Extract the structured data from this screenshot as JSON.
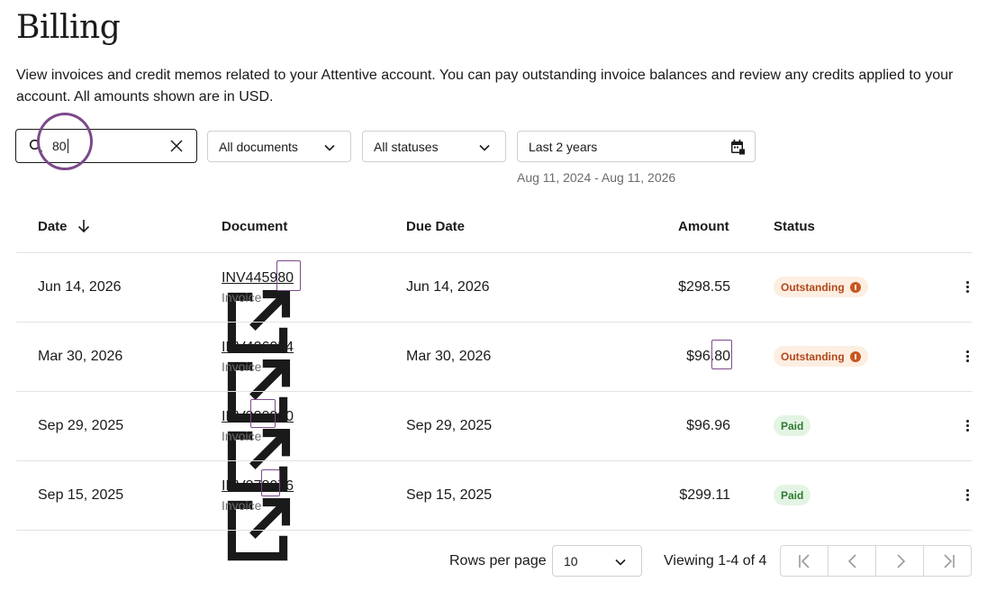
{
  "page": {
    "title": "Billing",
    "description": "View invoices and credit memos related to your Attentive account. You can pay outstanding invoice balances and review any credits applied to your account. All amounts shown are in USD."
  },
  "filters": {
    "search_value": "80",
    "document_select": "All documents",
    "status_select": "All statuses",
    "date_select": "Last 2 years",
    "date_range": "Aug 11, 2024 - Aug 11, 2026"
  },
  "table": {
    "headers": {
      "date": "Date",
      "document": "Document",
      "due_date": "Due Date",
      "amount": "Amount",
      "status": "Status"
    },
    "rows": [
      {
        "date": "Jun 14, 2026",
        "document": "INV445980",
        "doc_type": "Invoice",
        "due_date": "Jun 14, 2026",
        "amount": "$298.55",
        "status": "Outstanding",
        "status_kind": "outstanding"
      },
      {
        "date": "Mar 30, 2026",
        "document": "INV426054",
        "doc_type": "Invoice",
        "due_date": "Mar 30, 2026",
        "amount": "$96.80",
        "status": "Outstanding",
        "status_kind": "outstanding"
      },
      {
        "date": "Sep 29, 2025",
        "document": "INV380200",
        "doc_type": "Invoice",
        "due_date": "Sep 29, 2025",
        "amount": "$96.96",
        "status": "Paid",
        "status_kind": "paid"
      },
      {
        "date": "Sep 15, 2025",
        "document": "INV378076",
        "doc_type": "Invoice",
        "due_date": "Sep 15, 2025",
        "amount": "$299.11",
        "status": "Paid",
        "status_kind": "paid"
      }
    ]
  },
  "pagination": {
    "rows_per_page_label": "Rows per page",
    "rows_per_page": "10",
    "viewing": "Viewing 1-4 of 4"
  },
  "icons": {
    "search": "search-icon",
    "clear": "close-icon",
    "chevron": "chevron-down-icon",
    "calendar": "calendar-icon",
    "sort": "arrow-down-icon",
    "external": "external-link-icon",
    "info": "info-icon",
    "more": "more-vertical-icon"
  },
  "colors": {
    "text": "#1a1a1a",
    "muted": "#6b6b6b",
    "outstanding_bg": "#fdeee2",
    "outstanding_text": "#b3471b",
    "paid_bg": "#e4f4e4",
    "paid_text": "#2e7a32",
    "highlight": "#7b4a8a"
  }
}
